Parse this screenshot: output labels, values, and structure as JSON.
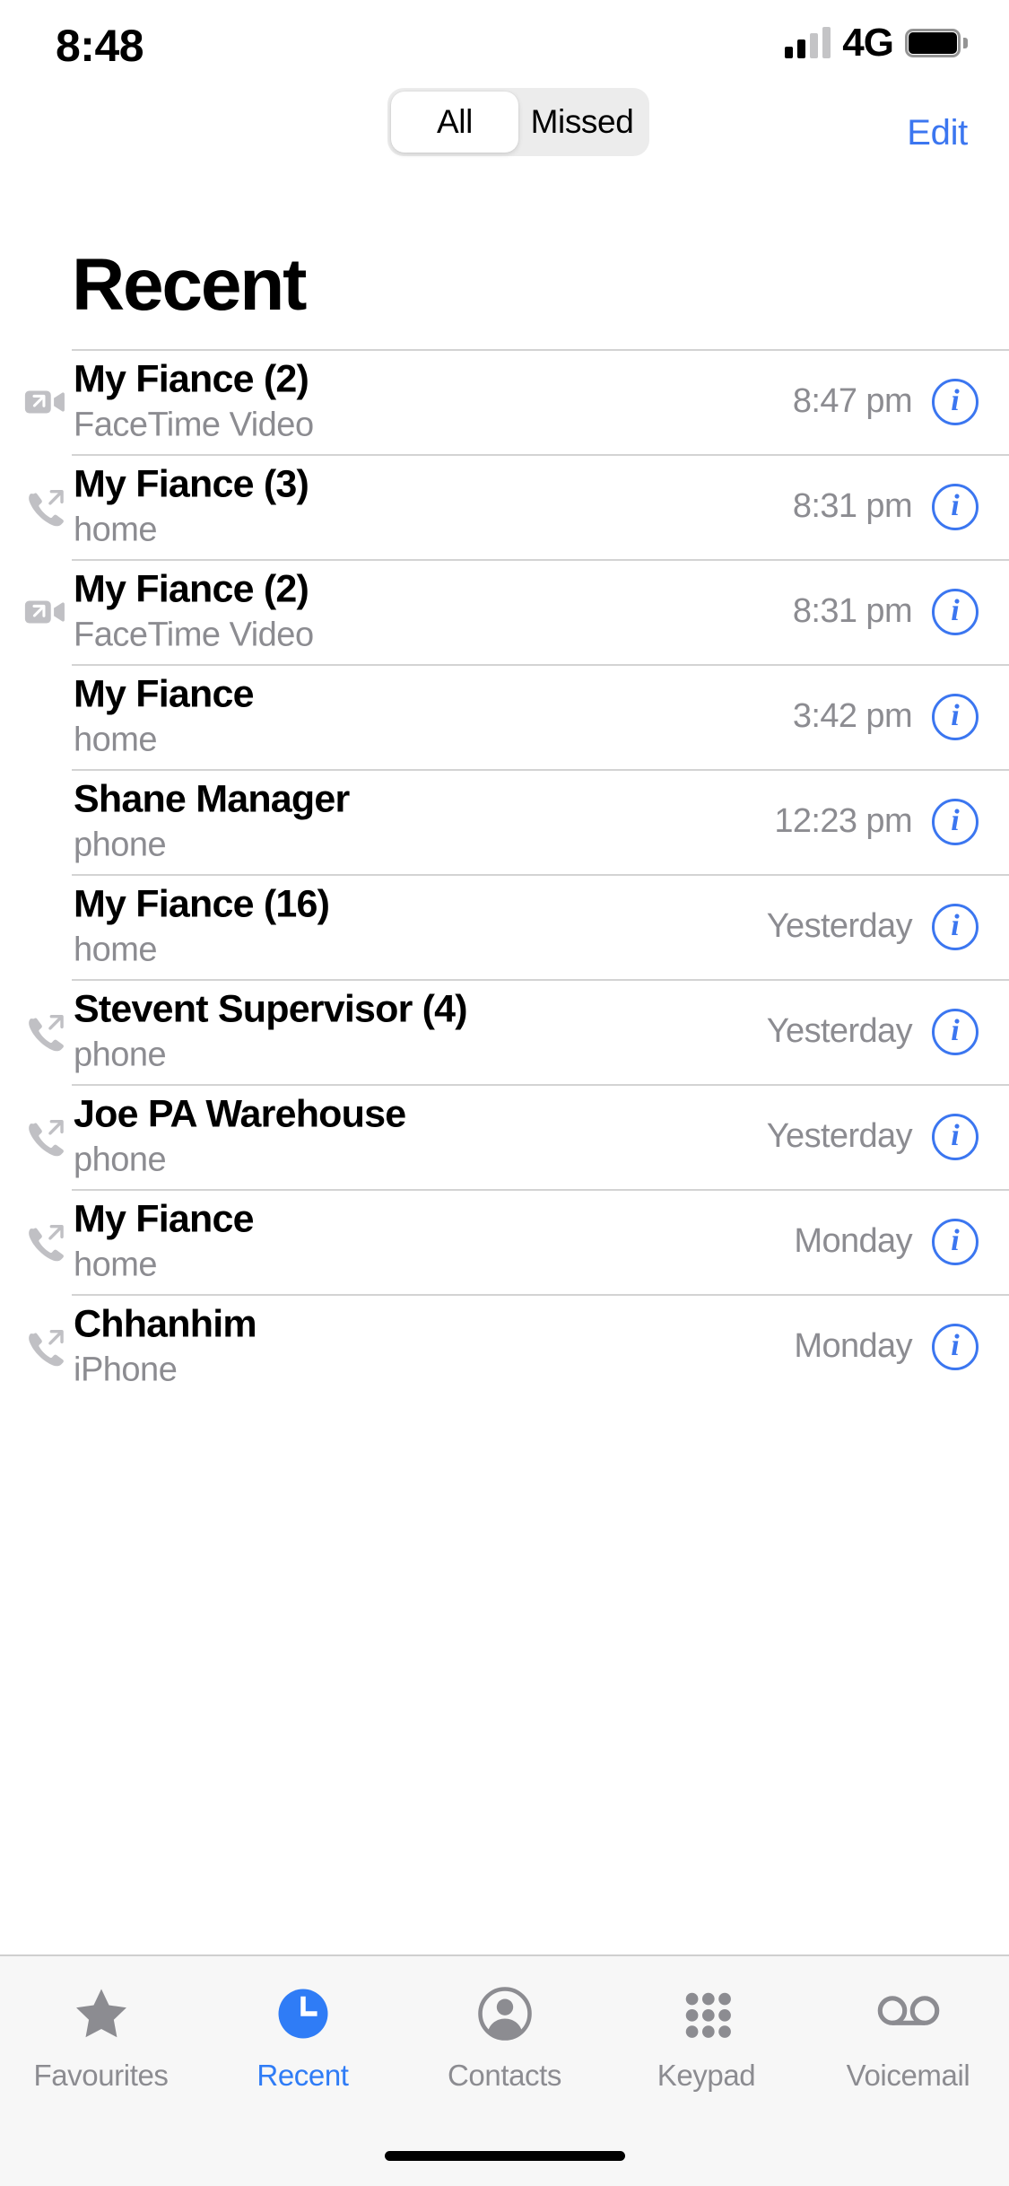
{
  "status_bar": {
    "time": "8:48",
    "network": "4G",
    "signal_icon": "signal-bars-icon",
    "battery_icon": "battery-full-icon"
  },
  "header": {
    "title": "Recent",
    "edit_label": "Edit",
    "segments": [
      {
        "label": "All",
        "selected": true
      },
      {
        "label": "Missed",
        "selected": false
      }
    ]
  },
  "accent_color": "#3b76f0",
  "calls": [
    {
      "name": "My Fiance (2)",
      "subtitle": "FaceTime Video",
      "time": "8:47 pm",
      "icon": "facetime-video-outgoing-icon",
      "info_icon": "info-circle-icon"
    },
    {
      "name": "My Fiance (3)",
      "subtitle": "home",
      "time": "8:31 pm",
      "icon": "phone-outgoing-icon",
      "info_icon": "info-circle-icon"
    },
    {
      "name": "My Fiance (2)",
      "subtitle": "FaceTime Video",
      "time": "8:31 pm",
      "icon": "facetime-video-outgoing-icon",
      "info_icon": "info-circle-icon"
    },
    {
      "name": "My Fiance",
      "subtitle": "home",
      "time": "3:42 pm",
      "icon": "none",
      "info_icon": "info-circle-icon"
    },
    {
      "name": "Shane Manager",
      "subtitle": "phone",
      "time": "12:23 pm",
      "icon": "none",
      "info_icon": "info-circle-icon"
    },
    {
      "name": "My Fiance (16)",
      "subtitle": "home",
      "time": "Yesterday",
      "icon": "none",
      "info_icon": "info-circle-icon"
    },
    {
      "name": "Stevent Supervisor (4)",
      "subtitle": "phone",
      "time": "Yesterday",
      "icon": "phone-outgoing-icon",
      "info_icon": "info-circle-icon"
    },
    {
      "name": "Joe PA Warehouse",
      "subtitle": "phone",
      "time": "Yesterday",
      "icon": "phone-outgoing-icon",
      "info_icon": "info-circle-icon"
    },
    {
      "name": "My Fiance",
      "subtitle": "home",
      "time": "Monday",
      "icon": "phone-outgoing-icon",
      "info_icon": "info-circle-icon"
    },
    {
      "name": "Chhanhim",
      "subtitle": "iPhone",
      "time": "Monday",
      "icon": "phone-outgoing-icon",
      "info_icon": "info-circle-icon"
    }
  ],
  "tabs": [
    {
      "label": "Favourites",
      "icon": "star-icon",
      "active": false
    },
    {
      "label": "Recent",
      "icon": "clock-icon",
      "active": true
    },
    {
      "label": "Contacts",
      "icon": "person-icon",
      "active": false
    },
    {
      "label": "Keypad",
      "icon": "keypad-icon",
      "active": false
    },
    {
      "label": "Voicemail",
      "icon": "voicemail-icon",
      "active": false
    }
  ]
}
